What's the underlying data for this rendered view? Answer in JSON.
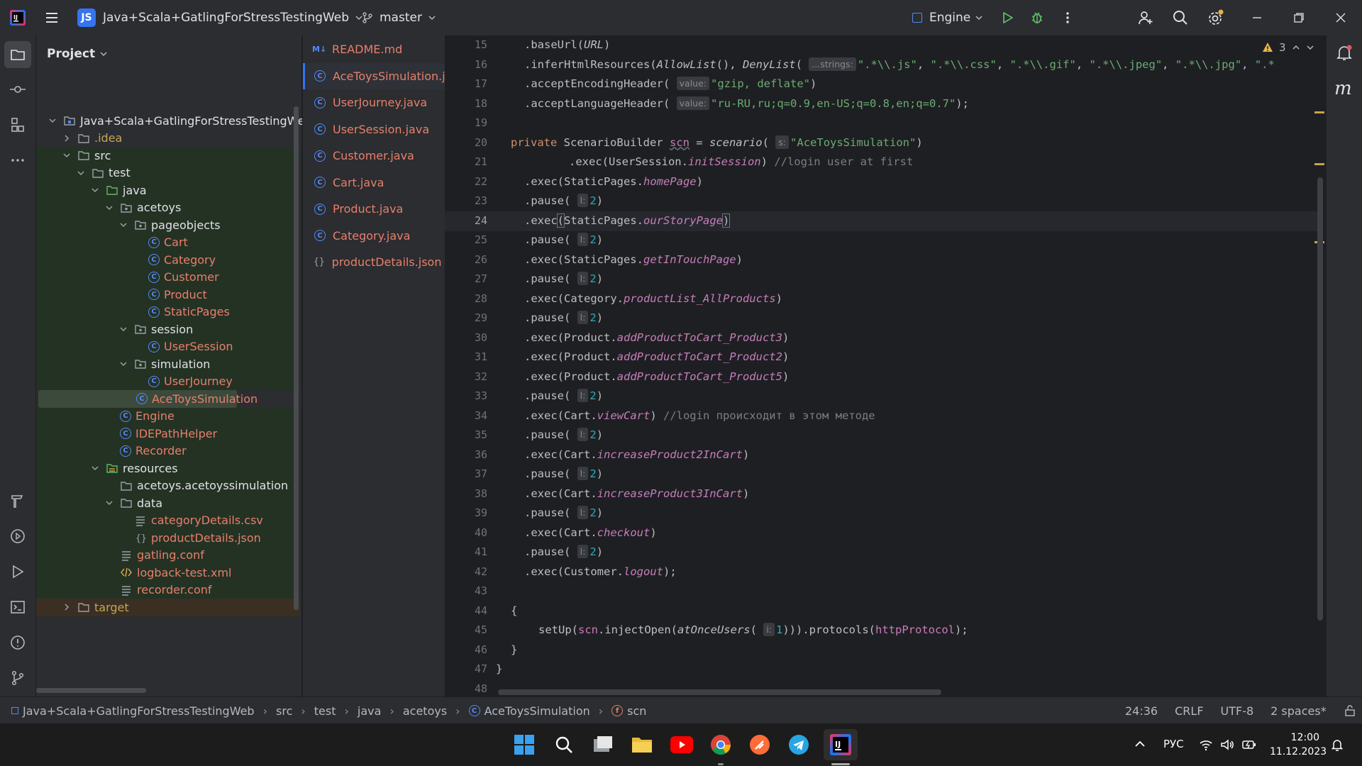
{
  "titlebar": {
    "project_badge": "JS",
    "project_name": "Java+Scala+GatlingForStressTestingWeb",
    "branch": "master",
    "run_config": "Engine",
    "warning_count": "3"
  },
  "project_panel": {
    "title": "Project",
    "tree": [
      {
        "label": "Java+Scala+GatlingForStressTestingWeb",
        "indent": 0,
        "type": "module",
        "expanded": true
      },
      {
        "label": ".idea",
        "indent": 1,
        "type": "folder",
        "expanded": false,
        "color": "idea"
      },
      {
        "label": "src",
        "indent": 1,
        "type": "folder",
        "expanded": true
      },
      {
        "label": "test",
        "indent": 2,
        "type": "folder",
        "expanded": true
      },
      {
        "label": "java",
        "indent": 3,
        "type": "srcfolder",
        "expanded": true
      },
      {
        "label": "acetoys",
        "indent": 4,
        "type": "package",
        "expanded": true
      },
      {
        "label": "pageobjects",
        "indent": 5,
        "type": "package",
        "expanded": true
      },
      {
        "label": "Cart",
        "indent": 6,
        "type": "class"
      },
      {
        "label": "Category",
        "indent": 6,
        "type": "class"
      },
      {
        "label": "Customer",
        "indent": 6,
        "type": "class"
      },
      {
        "label": "Product",
        "indent": 6,
        "type": "class"
      },
      {
        "label": "StaticPages",
        "indent": 6,
        "type": "class"
      },
      {
        "label": "session",
        "indent": 5,
        "type": "package",
        "expanded": true
      },
      {
        "label": "UserSession",
        "indent": 6,
        "type": "class"
      },
      {
        "label": "simulation",
        "indent": 5,
        "type": "package",
        "expanded": true
      },
      {
        "label": "UserJourney",
        "indent": 6,
        "type": "class"
      },
      {
        "label": "AceToysSimulation",
        "indent": 5,
        "type": "class",
        "selected": true
      },
      {
        "label": "Engine",
        "indent": 4,
        "type": "class"
      },
      {
        "label": "IDEPathHelper",
        "indent": 4,
        "type": "class"
      },
      {
        "label": "Recorder",
        "indent": 4,
        "type": "class"
      },
      {
        "label": "resources",
        "indent": 3,
        "type": "resfolder",
        "expanded": true
      },
      {
        "label": "acetoys.acetoyssimulation",
        "indent": 4,
        "type": "folder-plain"
      },
      {
        "label": "data",
        "indent": 4,
        "type": "folder",
        "expanded": true
      },
      {
        "label": "categoryDetails.csv",
        "indent": 5,
        "type": "textfile"
      },
      {
        "label": "productDetails.json",
        "indent": 5,
        "type": "json"
      },
      {
        "label": "gatling.conf",
        "indent": 4,
        "type": "textfile"
      },
      {
        "label": "logback-test.xml",
        "indent": 4,
        "type": "xml"
      },
      {
        "label": "recorder.conf",
        "indent": 4,
        "type": "textfile"
      },
      {
        "label": "target",
        "indent": 1,
        "type": "folder",
        "expanded": false,
        "color": "excluded"
      }
    ]
  },
  "tabs": [
    {
      "label": "README.md",
      "type": "md"
    },
    {
      "label": "AceToysSimulation.java",
      "type": "class",
      "active": true
    },
    {
      "label": "UserJourney.java",
      "type": "class"
    },
    {
      "label": "UserSession.java",
      "type": "class"
    },
    {
      "label": "Customer.java",
      "type": "class"
    },
    {
      "label": "Cart.java",
      "type": "class"
    },
    {
      "label": "Product.java",
      "type": "class"
    },
    {
      "label": "Category.java",
      "type": "class"
    },
    {
      "label": "productDetails.json",
      "type": "json"
    }
  ],
  "editor": {
    "current_line": 24,
    "line_numbers": [
      "15",
      "16",
      "17",
      "18",
      "19",
      "20",
      "21",
      "22",
      "23",
      "24",
      "25",
      "26",
      "27",
      "28",
      "29",
      "30",
      "31",
      "32",
      "33",
      "34",
      "35",
      "36",
      "37",
      "38",
      "39",
      "40",
      "41",
      "42",
      "43",
      "44",
      "45",
      "46",
      "47",
      "48"
    ]
  },
  "statusbar": {
    "breadcrumbs": [
      "Java+Scala+GatlingForStressTestingWeb",
      "src",
      "test",
      "java",
      "acetoys",
      "AceToysSimulation",
      "scn"
    ],
    "position": "24:36",
    "line_ending": "CRLF",
    "encoding": "UTF-8",
    "indent": "2 spaces*"
  },
  "taskbar": {
    "language": "РУС",
    "time": "12:00",
    "date": "11.12.2023"
  }
}
